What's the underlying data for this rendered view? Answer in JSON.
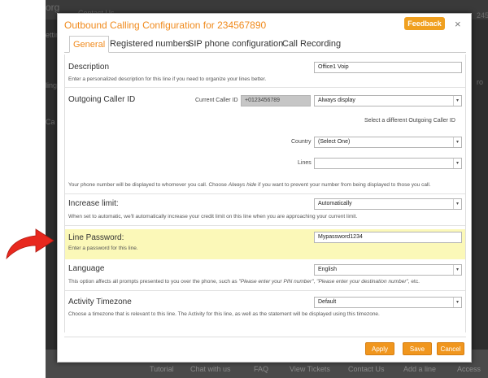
{
  "background": {
    "header_text": "Contact Us",
    "left_fragments": [
      "org",
      "ettings",
      "ling",
      "Ca"
    ],
    "right_fragments": [
      "2456",
      "ro"
    ],
    "bottom_links": [
      "Tutorial",
      "Chat with us",
      "FAQ",
      "View Tickets",
      "Contact Us",
      "Add a line",
      "Access"
    ]
  },
  "modal": {
    "title": "Outbound Calling Configuration for 234567890",
    "feedback_label": "Feedback",
    "close_symbol": "×",
    "tabs": [
      {
        "label": "General",
        "active": true
      },
      {
        "label": "Registered numbers",
        "active": false
      },
      {
        "label": "SIP phone configuration",
        "active": false
      },
      {
        "label": "Call Recording",
        "active": false
      }
    ],
    "description": {
      "label": "Description",
      "help": "Enter a personalized description for this line if you need to organize your lines better.",
      "value": "Office1 Voip"
    },
    "caller_id": {
      "label": "Outgoing Caller ID",
      "current_label": "Current Caller ID",
      "current_value": "+0123456789",
      "display_option": "Always display",
      "select_different_link": "Select a different Outgoing Caller ID",
      "country_label": "Country",
      "country_value": "(Select One)",
      "lines_label": "Lines",
      "lines_value": "",
      "help_part1": "Your phone number will be displayed to whomever you call. Choose ",
      "help_em": "Always hide",
      "help_part2": " if you want to prevent your number from being displayed to those you call."
    },
    "increase_limit": {
      "label": "Increase limit:",
      "value": "Automatically",
      "help": "When set to automatic, we'll automatically increase your credit limit on this line when you are approaching your current limit."
    },
    "line_password": {
      "label": "Line Password:",
      "help": "Enter a password for this line.",
      "value": "Mypassword1234"
    },
    "language": {
      "label": "Language",
      "value": "English",
      "help_part1": "This option affects all prompts presented to you over the phone, such as ",
      "help_em1": "\"Please enter your PIN number\"",
      "help_part2": ", ",
      "help_em2": "\"Please enter your destination number\"",
      "help_part3": ", etc."
    },
    "timezone": {
      "label": "Activity Timezone",
      "value": "Default",
      "help": "Choose a timezone that is relevant to this line. The Activity for this line, as well as the statement will be displayed using this timezone."
    },
    "buttons": {
      "apply": "Apply",
      "save": "Save",
      "cancel": "Cancel"
    }
  },
  "colors": {
    "accent": "#f08a1c",
    "highlight": "#fbf8b8",
    "arrow": "#e8281e"
  },
  "icons": {
    "pointer": "red-curved-arrow-icon",
    "select_chevron": "chevron-down-icon",
    "close": "close-icon"
  }
}
